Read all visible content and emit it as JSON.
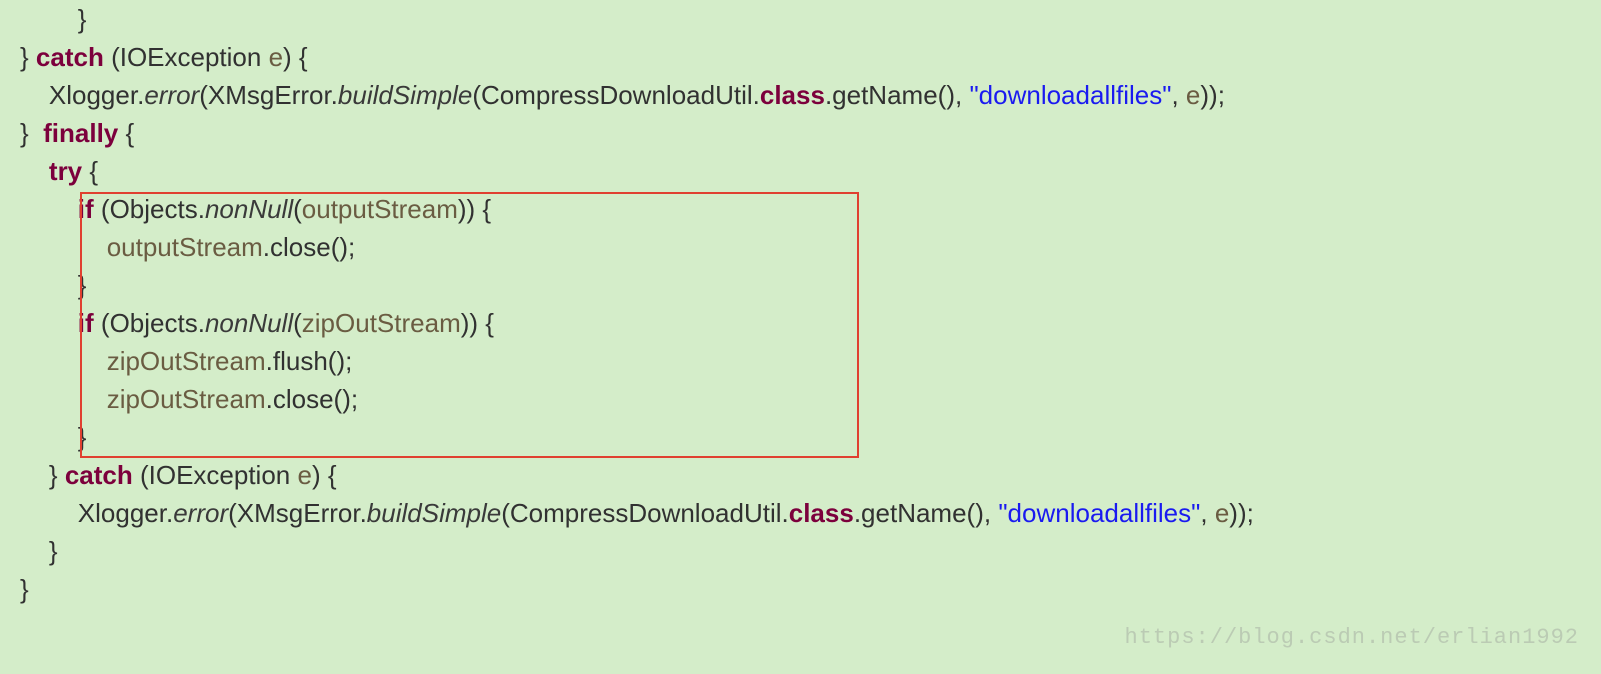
{
  "code": {
    "l1": "        }",
    "l2a": "} ",
    "l2b": "catch",
    "l2c": " (IOException ",
    "l2d": "e",
    "l2e": ") {",
    "l3a": "    Xlogger.",
    "l3b": "error",
    "l3c": "(XMsgError.",
    "l3d": "buildSimple",
    "l3e": "(CompressDownloadUtil.",
    "l3f": "class",
    "l3g": ".getName(), ",
    "l3h": "\"downloadallfiles\"",
    "l3i": ", ",
    "l3j": "e",
    "l3k": "));",
    "l4a": "}  ",
    "l4b": "finally",
    "l4c": " {",
    "l5a": "    ",
    "l5b": "try",
    "l5c": " {",
    "l6a": "        ",
    "l6b": "if",
    "l6c": " (Objects.",
    "l6d": "nonNull",
    "l6e": "(",
    "l6f": "outputStream",
    "l6g": ")) {",
    "l7a": "            ",
    "l7b": "outputStream",
    "l7c": ".close();",
    "l8": "        }",
    "l9a": "        ",
    "l9b": "if",
    "l9c": " (Objects.",
    "l9d": "nonNull",
    "l9e": "(",
    "l9f": "zipOutStream",
    "l9g": ")) {",
    "l10a": "            ",
    "l10b": "zipOutStream",
    "l10c": ".flush();",
    "l11a": "            ",
    "l11b": "zipOutStream",
    "l11c": ".close();",
    "l12": "        }",
    "l13a": "    } ",
    "l13b": "catch",
    "l13c": " (IOException ",
    "l13d": "e",
    "l13e": ") {",
    "l14a": "        Xlogger.",
    "l14b": "error",
    "l14c": "(XMsgError.",
    "l14d": "buildSimple",
    "l14e": "(CompressDownloadUtil.",
    "l14f": "class",
    "l14g": ".getName(), ",
    "l14h": "\"downloadallfiles\"",
    "l14i": ", ",
    "l14j": "e",
    "l14k": "));",
    "l15": "    }",
    "l16": "}"
  },
  "watermark": "https://blog.csdn.net/erlian1992"
}
